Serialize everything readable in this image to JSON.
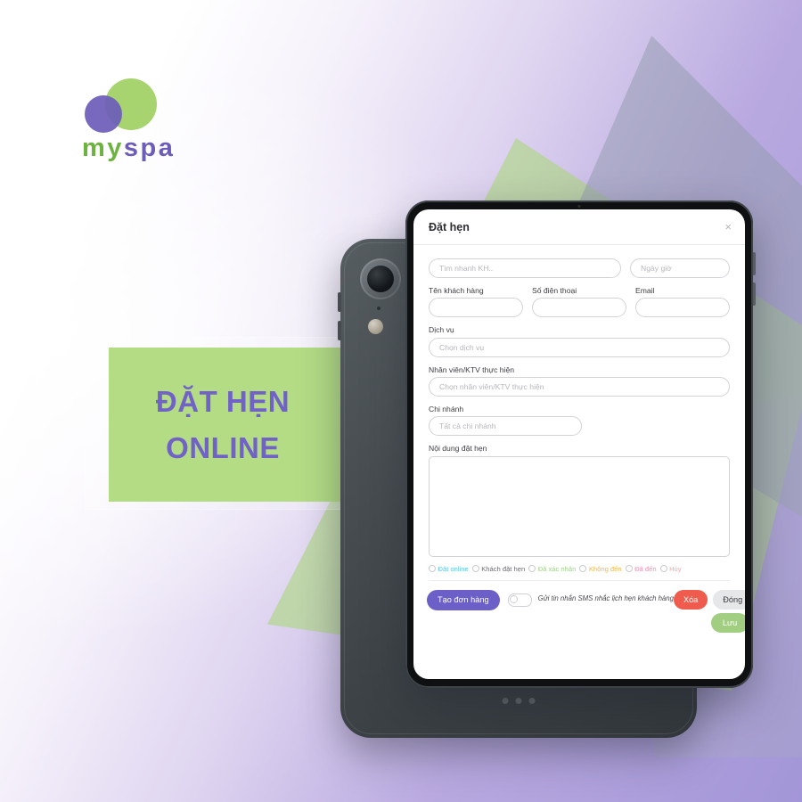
{
  "brand": {
    "name_part1": "my",
    "name_part2": "spa",
    "green": "#a7d46e",
    "purple": "#6d5cb8"
  },
  "headline": {
    "line1": "ĐẶT HẸN",
    "line2": "ONLINE",
    "panel_color": "#b3dc85",
    "text_color": "#7163c6"
  },
  "dialog": {
    "title": "Đặt hẹn",
    "close_label": "×",
    "quick_search_placeholder": "Tìm nhanh KH..",
    "datetime_placeholder": "Ngày giờ",
    "fields": [
      {
        "label": "Tên khách hàng",
        "value": ""
      },
      {
        "label": "Số điện thoại",
        "value": ""
      },
      {
        "label": "Email",
        "value": ""
      }
    ],
    "service": {
      "label": "Dịch vụ",
      "placeholder": "Chọn dịch vụ"
    },
    "staff": {
      "label": "Nhân viên/KTV thực hiện",
      "placeholder": "Chọn nhân viên/KTV thực hiện"
    },
    "branch": {
      "label": "Chi nhánh",
      "placeholder": "Tất cả chi nhánh"
    },
    "note": {
      "label": "Nội dung đặt hẹn",
      "value": ""
    },
    "statuses": [
      {
        "label": "Đặt online",
        "color": "#52c8ee"
      },
      {
        "label": "Khách đặt hẹn",
        "color": "#6b6b72"
      },
      {
        "label": "Đã xác nhận",
        "color": "#9fd18a"
      },
      {
        "label": "Không đến",
        "color": "#f3b63f"
      },
      {
        "label": "Đã đến",
        "color": "#f58fb4"
      },
      {
        "label": "Hủy",
        "color": "#f8a6a6"
      }
    ],
    "footer": {
      "create_order_label": "Tạo đơn hàng",
      "sms_note": "Gửi tin nhắn SMS nhắc lịch hẹn khách hàng",
      "sms_toggle_on": false,
      "delete_label": "Xóa",
      "close_label": "Đóng",
      "save_label": "Lưu"
    }
  }
}
